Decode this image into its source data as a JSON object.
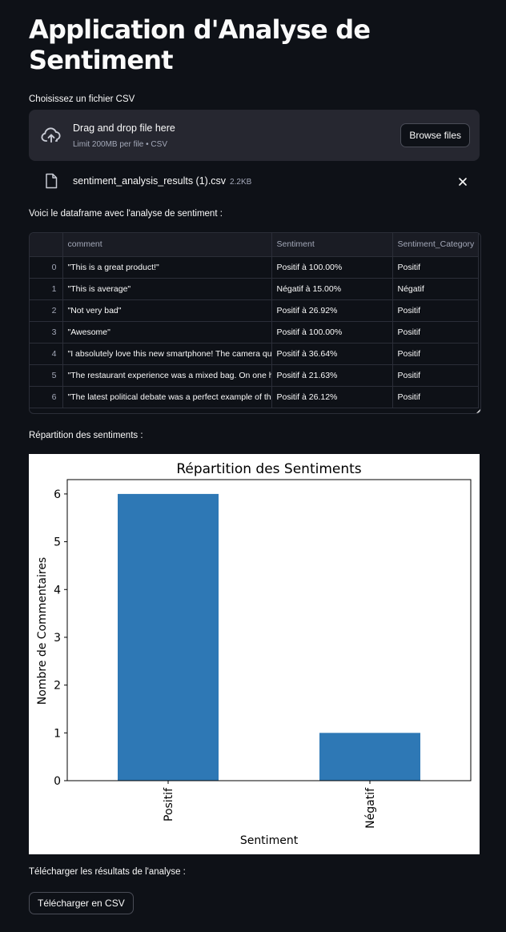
{
  "app": {
    "title": "Application d'Analyse de Sentiment"
  },
  "uploader": {
    "label": "Choisissez un fichier CSV",
    "drop_title": "Drag and drop file here",
    "limit_text": "Limit 200MB per file • CSV",
    "browse_label": "Browse files",
    "file_name": "sentiment_analysis_results (1).csv",
    "file_size": "2.2KB"
  },
  "dataframe": {
    "label": "Voici le dataframe avec l'analyse de sentiment :",
    "columns": [
      "",
      "comment",
      "Sentiment",
      "Sentiment_Category"
    ],
    "rows": [
      [
        "0",
        "\"This is a great product!\"",
        "Positif à 100.00%",
        "Positif"
      ],
      [
        "1",
        "\"This is average\"",
        "Négatif à 15.00%",
        "Négatif"
      ],
      [
        "2",
        "\"Not very bad\"",
        "Positif à 26.92%",
        "Positif"
      ],
      [
        "3",
        "\"Awesome\"",
        "Positif à 100.00%",
        "Positif"
      ],
      [
        "4",
        "\"I absolutely love this new smartphone! The camera qu",
        "Positif à 36.64%",
        "Positif"
      ],
      [
        "5",
        "\"The restaurant experience was a mixed bag. On one ha",
        "Positif à 21.63%",
        "Positif"
      ],
      [
        "6",
        "\"The latest political debate was a perfect example of th",
        "Positif à 26.12%",
        "Positif"
      ]
    ]
  },
  "chart_section": {
    "label": "Répartition des sentiments :"
  },
  "chart_data": {
    "type": "bar",
    "title": "Répartition des Sentiments",
    "categories": [
      "Positif",
      "Négatif"
    ],
    "values": [
      6,
      1
    ],
    "xlabel": "Sentiment",
    "ylabel": "Nombre de Commentaires",
    "ylim": [
      0,
      6.3
    ],
    "yticks": [
      "0",
      "1",
      "2",
      "3",
      "4",
      "5",
      "6"
    ],
    "grid": false,
    "bar_color": "#2e78b5"
  },
  "download": {
    "label": "Télécharger les résultats de l'analyse :",
    "button_label": "Télécharger en CSV"
  },
  "colors": {
    "background": "#0e1117",
    "panel": "#262730",
    "text": "#fafafa",
    "muted": "#a3a8b8"
  }
}
